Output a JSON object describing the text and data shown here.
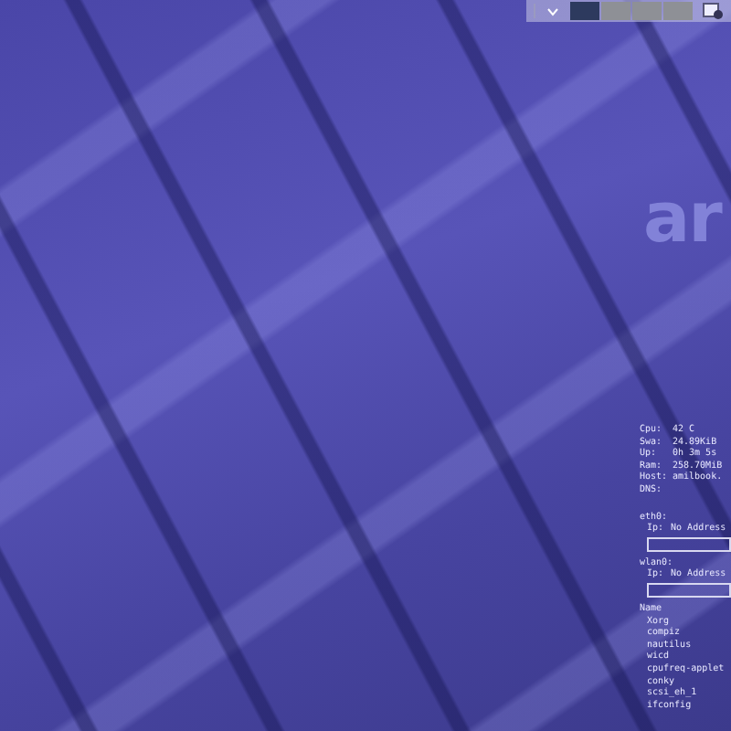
{
  "panel": {
    "workspaces": [
      {
        "selected": true
      },
      {
        "selected": false
      },
      {
        "selected": false
      },
      {
        "selected": false
      }
    ]
  },
  "logo": {
    "text": "ar"
  },
  "conky": {
    "system": [
      {
        "label": "Cpu:",
        "value": "42 C"
      },
      {
        "label": "Swa:",
        "value": "24.89KiB"
      },
      {
        "label": "Up:",
        "value": "0h 3m 5s"
      },
      {
        "label": "Ram:",
        "value": "258.70MiB"
      },
      {
        "label": "Host:",
        "value": "amilbook."
      },
      {
        "label": "DNS:"
      }
    ],
    "interfaces": [
      {
        "name": "eth0:",
        "ip_label": "Ip:",
        "ip_value": "No Address"
      },
      {
        "name": "wlan0:",
        "ip_label": "Ip:",
        "ip_value": "No Address"
      }
    ],
    "processes_header": "Name",
    "processes": [
      "Xorg",
      "compiz",
      "nautilus",
      "wicd",
      "cpufreq-applet",
      "conky",
      "scsi_eh_1",
      "ifconfig"
    ]
  }
}
